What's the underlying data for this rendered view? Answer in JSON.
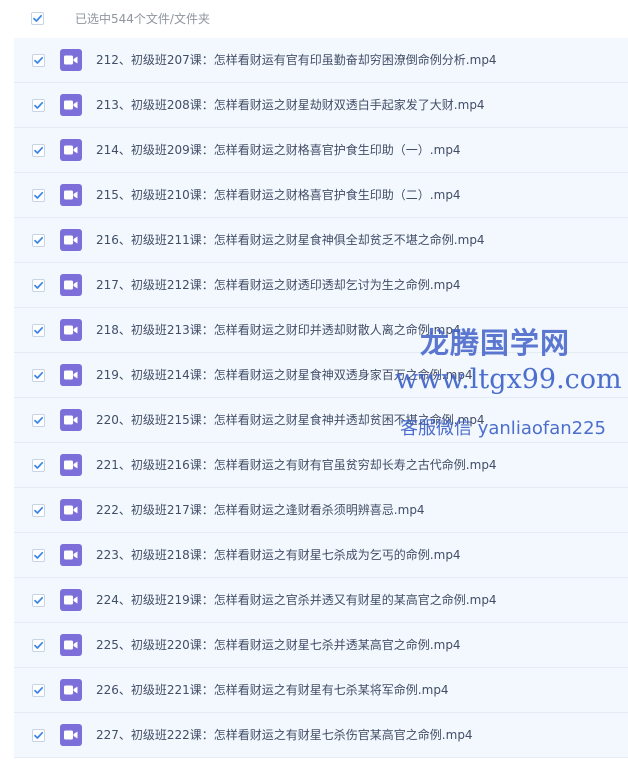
{
  "header": {
    "selection_summary": "已选中544个文件/文件夹"
  },
  "files": [
    {
      "name": "212、初级班207课：怎样看财运有官有印虽勤奋却穷困潦倒命例分析.mp4"
    },
    {
      "name": "213、初级班208课：怎样看财运之财星劫财双透白手起家发了大财.mp4"
    },
    {
      "name": "214、初级班209课：怎样看财运之财格喜官护食生印助（一）.mp4"
    },
    {
      "name": "215、初级班210课：怎样看财运之财格喜官护食生印助（二）.mp4"
    },
    {
      "name": "216、初级班211课：怎样看财运之财星食神俱全却贫乏不堪之命例.mp4"
    },
    {
      "name": "217、初级班212课：怎样看财运之财透印透却乞讨为生之命例.mp4"
    },
    {
      "name": "218、初级班213课：怎样看财运之财印并透却财散人离之命例.mp4"
    },
    {
      "name": "219、初级班214课：怎样看财运之财星食神双透身家百万之命例.mp4"
    },
    {
      "name": "220、初级班215课：怎样看财运之财星食神并透却贫困不堪之命例.mp4"
    },
    {
      "name": "221、初级班216课：怎样看财运之有财有官虽贫穷却长寿之古代命例.mp4"
    },
    {
      "name": "222、初级班217课：怎样看财运之逢财看杀须明辨喜忌.mp4"
    },
    {
      "name": "223、初级班218课：怎样看财运之有财星七杀成为乞丐的命例.mp4"
    },
    {
      "name": "224、初级班219课：怎样看财运之官杀并透又有财星的某高官之命例.mp4"
    },
    {
      "name": "225、初级班220课：怎样看财运之财星七杀并透某高官之命例.mp4"
    },
    {
      "name": "226、初级班221课：怎样看财运之有财星有七杀某将军命例.mp4"
    },
    {
      "name": "227、初级班222课：怎样看财运之有财星七杀伤官某高官之命例.mp4"
    }
  ],
  "watermark": {
    "brand": "龙腾国学网",
    "url": "www.ltgx99.com",
    "contact": "客服微信 yanliaofan225"
  },
  "colors": {
    "accent": "#3a85e8",
    "file_icon": "#7d6fd9",
    "row_background": "#f3f8fe",
    "text": "#424e67",
    "watermark": "#3a5ec6"
  },
  "icons": {
    "checkbox": "check-icon",
    "file": "video-file-icon"
  }
}
